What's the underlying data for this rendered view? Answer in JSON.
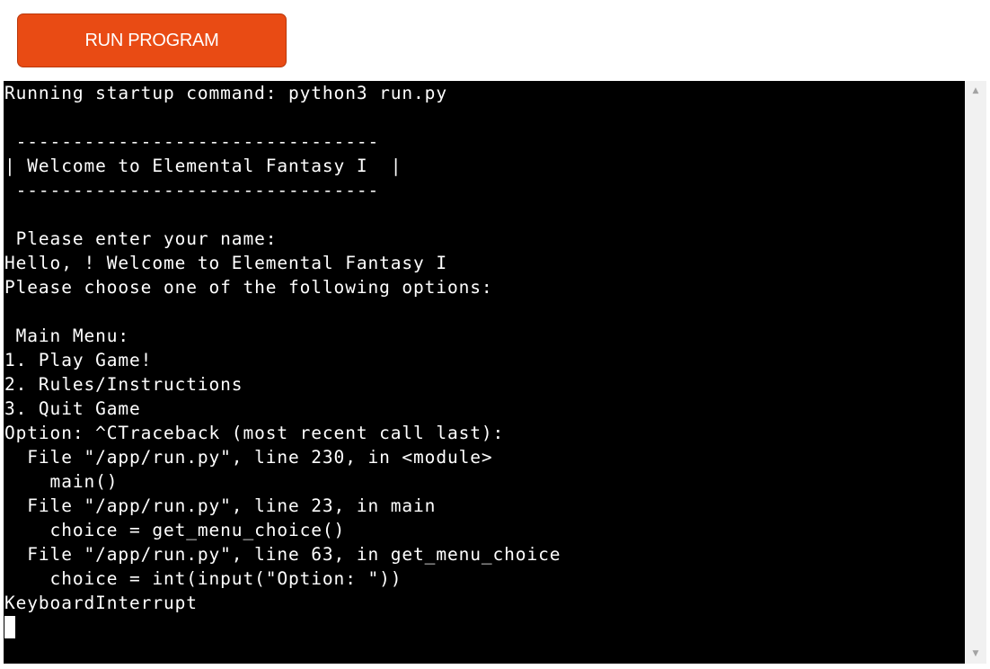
{
  "run_button": {
    "label": "RUN PROGRAM",
    "color": "#e94b14"
  },
  "terminal": {
    "background": "#000000",
    "foreground": "#ffffff",
    "output": "Running startup command: python3 run.py\n\n --------------------------------\n| Welcome to Elemental Fantasy I  |\n --------------------------------\n\n Please enter your name:\nHello, ! Welcome to Elemental Fantasy I\nPlease choose one of the following options:\n\n Main Menu:\n1. Play Game!\n2. Rules/Instructions\n3. Quit Game\nOption: ^CTraceback (most recent call last):\n  File \"/app/run.py\", line 230, in <module>\n    main()\n  File \"/app/run.py\", line 23, in main\n    choice = get_menu_choice()\n  File \"/app/run.py\", line 63, in get_menu_choice\n    choice = int(input(\"Option: \"))\nKeyboardInterrupt"
  },
  "scrollbar": {
    "up_icon": "scroll-up-arrow-icon",
    "down_icon": "scroll-down-arrow-icon",
    "up_glyph": "▲",
    "down_glyph": "▼"
  }
}
